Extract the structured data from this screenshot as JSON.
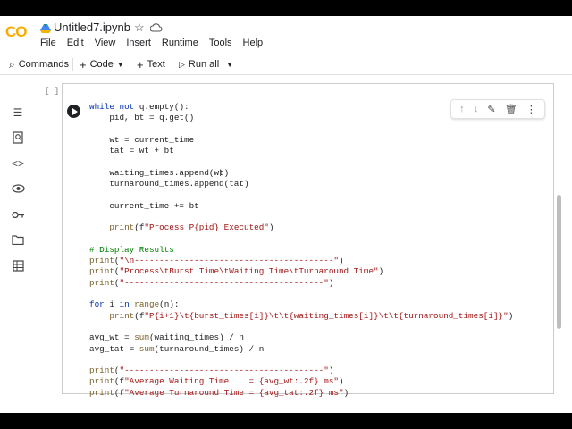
{
  "header": {
    "logo": "CO",
    "title": "Untitled7.ipynb",
    "menu": [
      "File",
      "Edit",
      "View",
      "Insert",
      "Runtime",
      "Tools",
      "Help"
    ]
  },
  "toolbar": {
    "commands": "Commands",
    "code": "Code",
    "text": "Text",
    "run_all": "Run all"
  },
  "cell": {
    "bracket": "[ ]",
    "lines": [
      "while not q.empty():",
      "    pid, bt = q.get()",
      "",
      "    wt = current_time",
      "    tat = wt + bt",
      "",
      "    waiting_times.append(wt)",
      "    turnaround_times.append(tat)",
      "",
      "    current_time += bt",
      "",
      "    print(f\"Process P{pid} Executed\")",
      "",
      "# Display Results",
      "print(\"\\n----------------------------------------\")",
      "print(\"Process\\tBurst Time\\tWaiting Time\\tTurnaround Time\")",
      "print(\"----------------------------------------\")",
      "",
      "for i in range(n):",
      "    print(f\"P{i+1}\\t{burst_times[i]}\\t\\t{waiting_times[i]}\\t\\t{turnaround_times[i]}\")",
      "",
      "avg_wt = sum(waiting_times) / n",
      "avg_tat = sum(turnaround_times) / n",
      "",
      "print(\"----------------------------------------\")",
      "print(f\"Average Waiting Time    = {avg_wt:.2f} ms\")",
      "print(f\"Average Turnaround Time = {avg_tat:.2f} ms\")"
    ]
  },
  "colors": {
    "accent": "#f9ab00",
    "keyword": "#0033b3",
    "string": "#a31515",
    "comment": "#008000"
  }
}
